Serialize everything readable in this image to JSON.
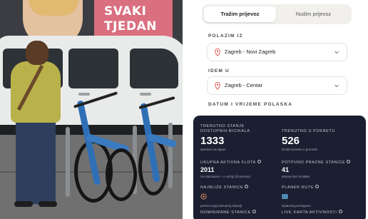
{
  "photo": {
    "billboard_line1": "SVAKI",
    "billboard_line2": "TJEDAN"
  },
  "booking": {
    "tabs": [
      {
        "label": "Tražim prijevoz",
        "active": true
      },
      {
        "label": "Nudim prijevoz",
        "active": false
      }
    ],
    "from": {
      "label": "POLAZIM IZ",
      "value": "Zagreb - Novi Zagreb",
      "icon": "map-pin-icon"
    },
    "to": {
      "label": "IDEM U",
      "value": "Zagreb - Centar",
      "icon": "map-pin-icon"
    },
    "datetime": {
      "label": "DATUM I VRIJEME POLASKA"
    },
    "accent_color": "#e0605a"
  },
  "stats": {
    "background": "#1a2031",
    "current_status": {
      "label_line1": "TRENUTNO STANJE",
      "label_line2": "DOSTUPNIH BICIKALA",
      "value": "1333",
      "sub": "spremni za najam"
    },
    "in_motion": {
      "label": "TRENUTNO U POKRETU",
      "value": "526",
      "sub": "bicikli trenutno u prometu"
    },
    "active_fleet": {
      "label": "UKUPNA AKTIVNA FLOTA",
      "value": "2011",
      "sub": "na stanicama + u vožnji (ili servisu)"
    },
    "empty_stations": {
      "label": "POTPUNO PRAZNE STANICE",
      "value": "41",
      "sub": "stanice bez bicikala"
    },
    "nearest_station": {
      "label": "NAJBLIŽE STANICE",
      "sub": "prema tvojoj trenutnoj lokaciji",
      "icon": "location-target-icon"
    },
    "route_planner": {
      "label": "PLANER RUTE",
      "sub": "isplaniraj put bajsom",
      "icon": "map-icon"
    },
    "nominated_stations": {
      "label": "NOMINIRANE STANICE"
    },
    "live_map": {
      "label": "LIVE KARTA AKTIVNOSTI"
    }
  }
}
